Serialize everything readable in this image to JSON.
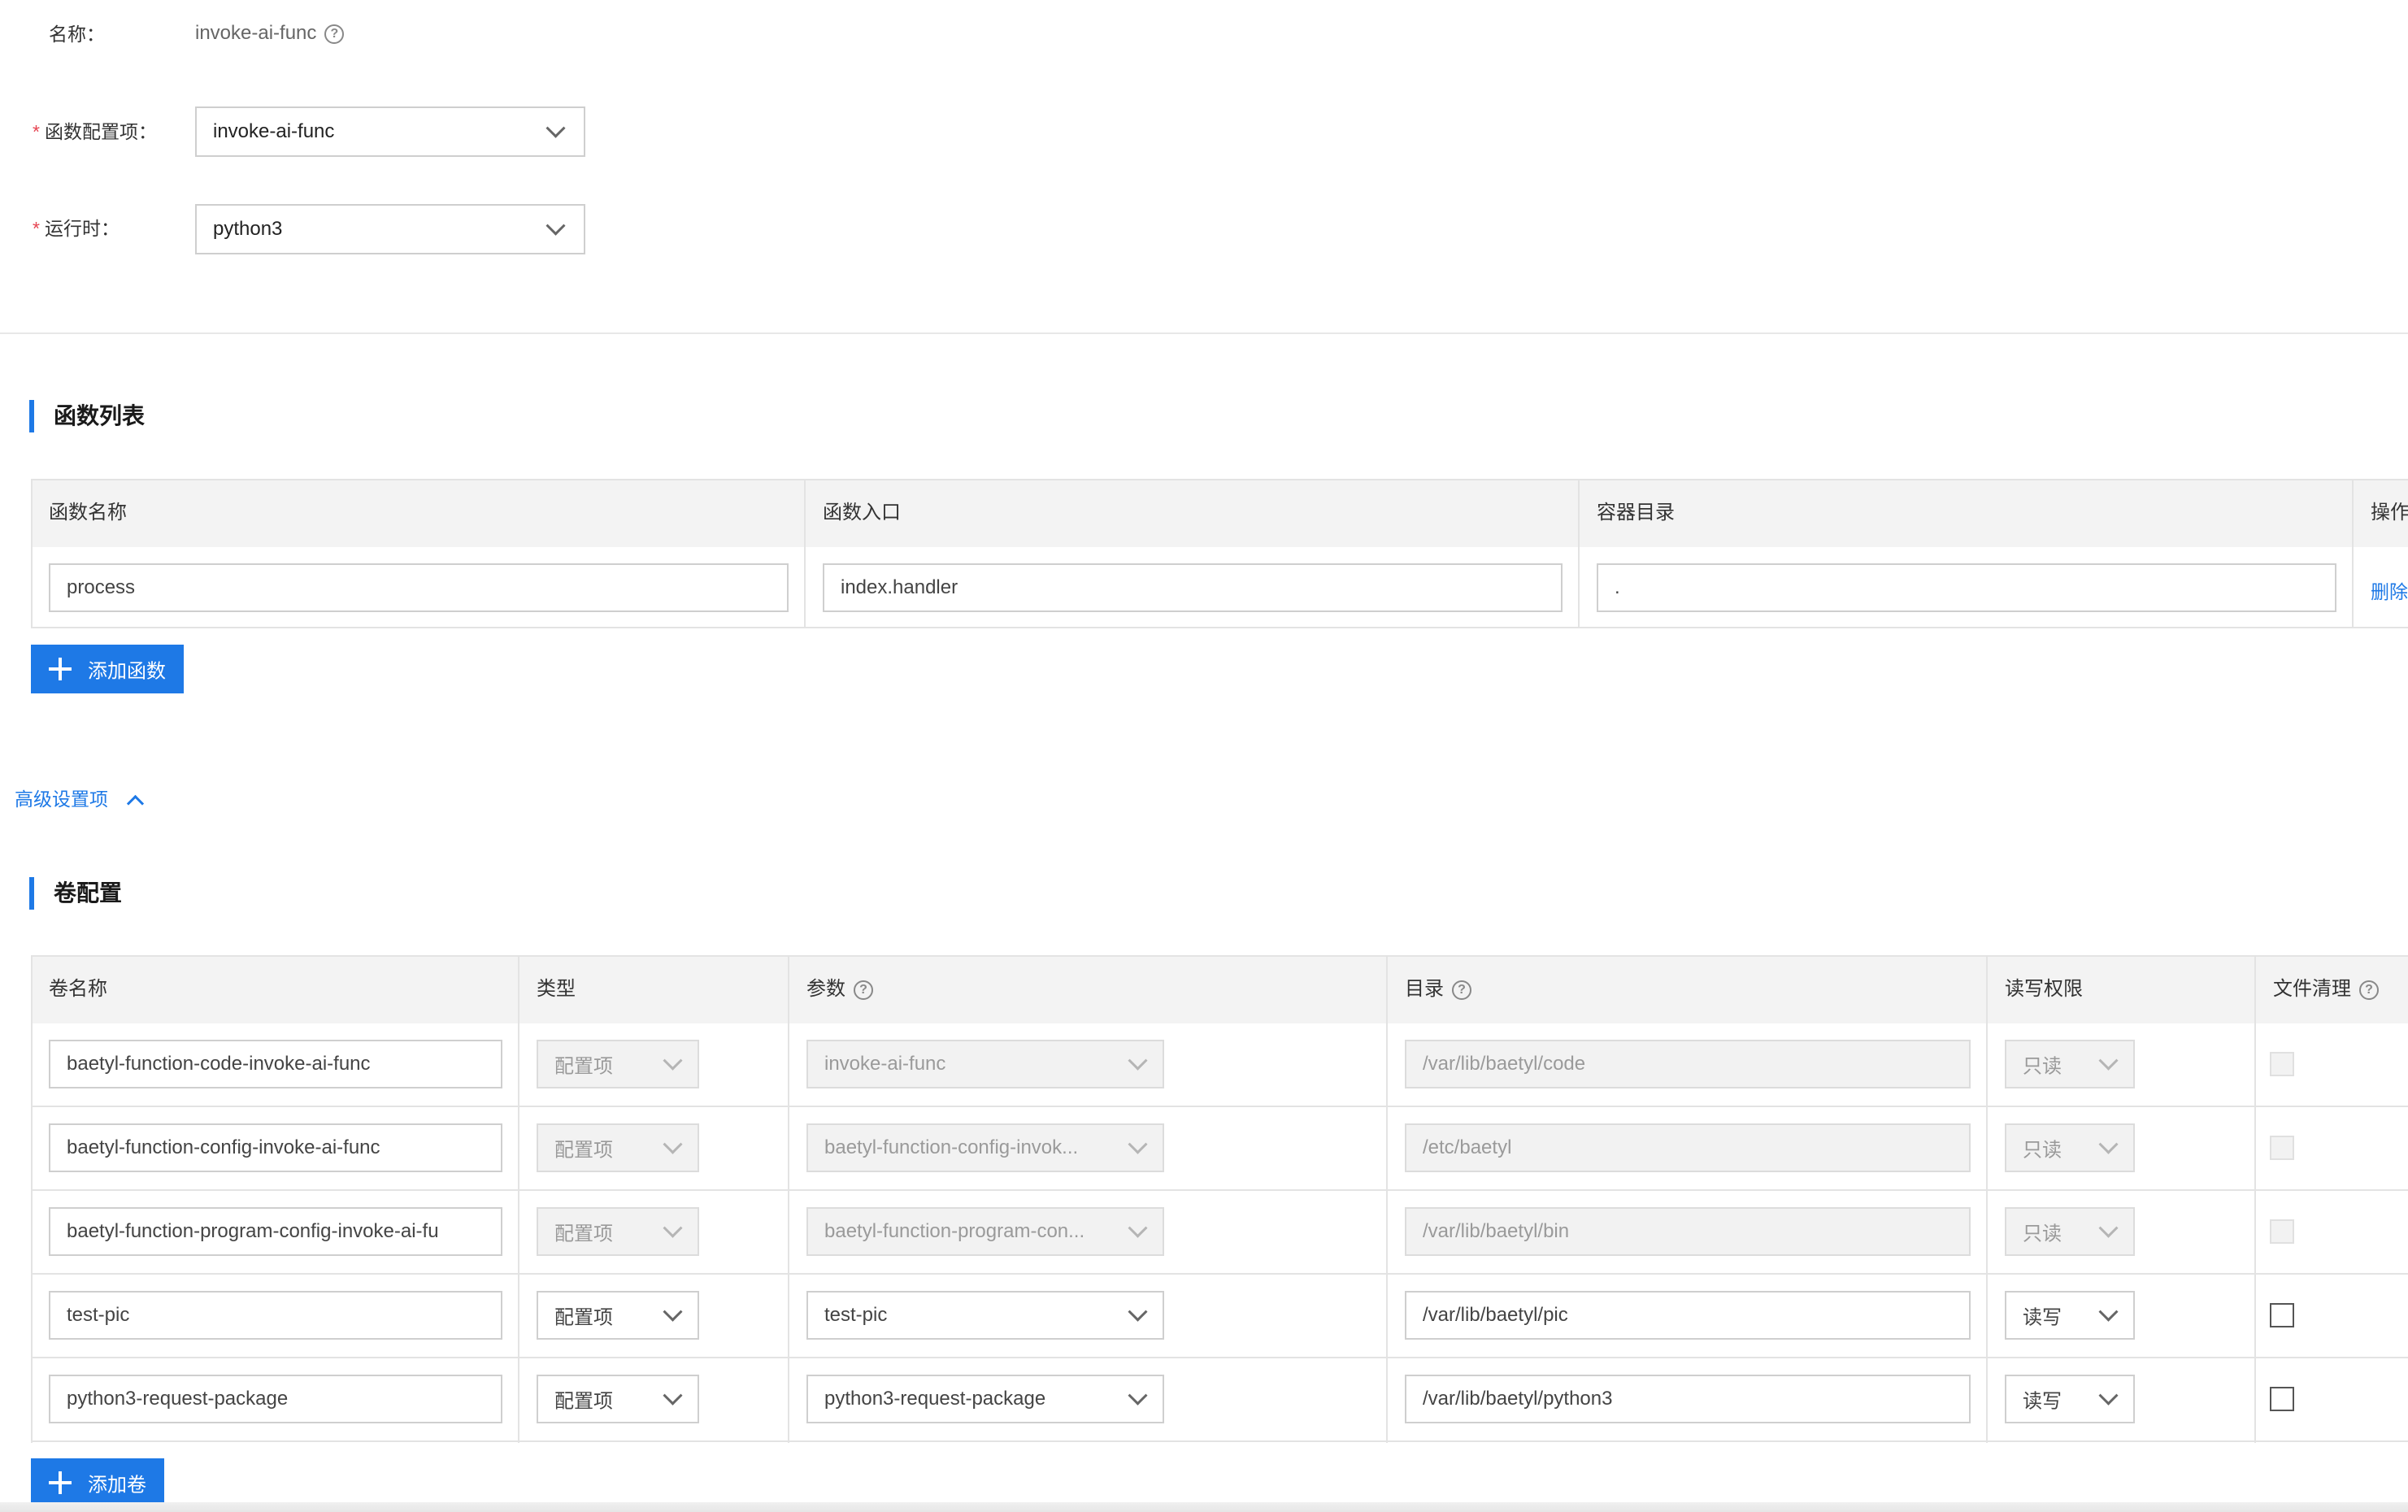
{
  "form": {
    "name_label": "名称：",
    "name_value": "invoke-ai-func",
    "config_label": "函数配置项：",
    "config_value": "invoke-ai-func",
    "runtime_label": "运行时：",
    "runtime_value": "python3",
    "required_mark": "*"
  },
  "functions": {
    "title": "函数列表",
    "headers": [
      "函数名称",
      "函数入口",
      "容器目录",
      "操作"
    ],
    "rows": [
      {
        "name": "process",
        "entry": "index.handler",
        "dir": ".",
        "action": "删除"
      }
    ],
    "add_label": "添加函数"
  },
  "advanced": {
    "label": "高级设置项"
  },
  "volumes": {
    "title": "卷配置",
    "headers": [
      "卷名称",
      "类型",
      "参数",
      "目录",
      "读写权限",
      "文件清理"
    ],
    "rows": [
      {
        "name": "baetyl-function-code-invoke-ai-func",
        "type": "配置项",
        "param": "invoke-ai-func",
        "dir": "/var/lib/baetyl/code",
        "perm": "只读",
        "disabled": true,
        "clean": false
      },
      {
        "name": "baetyl-function-config-invoke-ai-func",
        "type": "配置项",
        "param": "baetyl-function-config-invok...",
        "dir": "/etc/baetyl",
        "perm": "只读",
        "disabled": true,
        "clean": false
      },
      {
        "name": "baetyl-function-program-config-invoke-ai-fu",
        "type": "配置项",
        "param": "baetyl-function-program-con...",
        "dir": "/var/lib/baetyl/bin",
        "perm": "只读",
        "disabled": true,
        "clean": false
      },
      {
        "name": "test-pic",
        "type": "配置项",
        "param": "test-pic",
        "dir": "/var/lib/baetyl/pic",
        "perm": "读写",
        "disabled": false,
        "clean": false
      },
      {
        "name": "python3-request-package",
        "type": "配置项",
        "param": "python3-request-package",
        "dir": "/var/lib/baetyl/python3",
        "perm": "读写",
        "disabled": false,
        "clean": false
      }
    ],
    "add_label": "添加卷"
  },
  "icons": {
    "help": "question-circle-icon",
    "dropdown": "chevron-down-icon",
    "add": "plus-icon",
    "collapse": "chevron-up-icon"
  },
  "colors": {
    "primary": "#1e79e6",
    "required": "#e64552",
    "header_bg": "#f3f3f3",
    "disabled_bg": "#f2f2f2"
  }
}
